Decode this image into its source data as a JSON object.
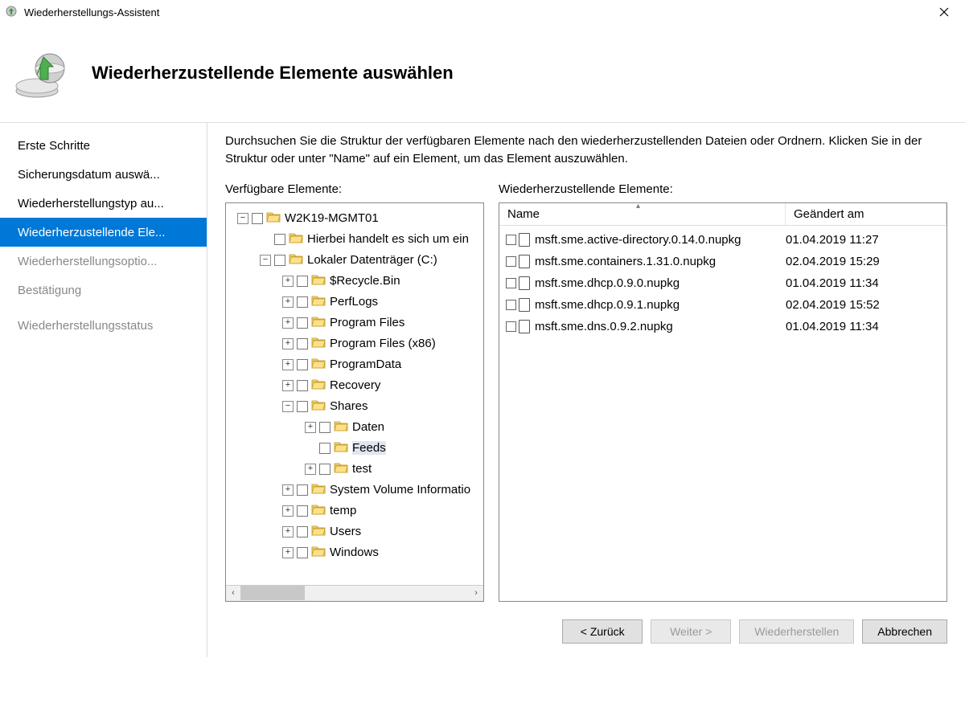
{
  "window": {
    "title": "Wiederherstellungs-Assistent"
  },
  "header": {
    "title": "Wiederherzustellende Elemente auswählen"
  },
  "steps": [
    {
      "label": "Erste Schritte",
      "state": "past"
    },
    {
      "label": "Sicherungsdatum auswä...",
      "state": "past"
    },
    {
      "label": "Wiederherstellungstyp au...",
      "state": "past"
    },
    {
      "label": "Wiederherzustellende Ele...",
      "state": "sel"
    },
    {
      "label": "Wiederherstellungsoptio...",
      "state": "dis"
    },
    {
      "label": "Bestätigung",
      "state": "dis"
    },
    {
      "label": "Wiederherstellungsstatus",
      "state": "dis"
    }
  ],
  "instructions": "Durchsuchen Sie die Struktur der verfügbaren Elemente nach den wiederherzustellenden Dateien oder Ordnern. Klicken Sie in der Struktur oder unter \"Name\" auf ein Element, um das Element auszuwählen.",
  "panes": {
    "left_label": "Verfügbare Elemente:",
    "right_label": "Wiederherzustellende Elemente:",
    "columns": {
      "name": "Name",
      "modified": "Geändert am"
    }
  },
  "tree": [
    {
      "depth": 0,
      "toggle": "-",
      "label": "W2K19-MGMT01",
      "selected": false
    },
    {
      "depth": 1,
      "toggle": "",
      "label": "Hierbei handelt es sich um ein",
      "selected": false
    },
    {
      "depth": 1,
      "toggle": "-",
      "label": "Lokaler Datenträger (C:)",
      "selected": false
    },
    {
      "depth": 2,
      "toggle": "+",
      "label": "$Recycle.Bin",
      "selected": false
    },
    {
      "depth": 2,
      "toggle": "+",
      "label": "PerfLogs",
      "selected": false
    },
    {
      "depth": 2,
      "toggle": "+",
      "label": "Program Files",
      "selected": false
    },
    {
      "depth": 2,
      "toggle": "+",
      "label": "Program Files (x86)",
      "selected": false
    },
    {
      "depth": 2,
      "toggle": "+",
      "label": "ProgramData",
      "selected": false
    },
    {
      "depth": 2,
      "toggle": "+",
      "label": "Recovery",
      "selected": false
    },
    {
      "depth": 2,
      "toggle": "-",
      "label": "Shares",
      "selected": false
    },
    {
      "depth": 3,
      "toggle": "+",
      "label": "Daten",
      "selected": false
    },
    {
      "depth": 3,
      "toggle": "",
      "label": "Feeds",
      "selected": true
    },
    {
      "depth": 3,
      "toggle": "+",
      "label": "test",
      "selected": false
    },
    {
      "depth": 2,
      "toggle": "+",
      "label": "System Volume Informatio",
      "selected": false
    },
    {
      "depth": 2,
      "toggle": "+",
      "label": "temp",
      "selected": false
    },
    {
      "depth": 2,
      "toggle": "+",
      "label": "Users",
      "selected": false
    },
    {
      "depth": 2,
      "toggle": "+",
      "label": "Windows",
      "selected": false
    }
  ],
  "files": [
    {
      "name": "msft.sme.active-directory.0.14.0.nupkg",
      "modified": "01.04.2019 11:27"
    },
    {
      "name": "msft.sme.containers.1.31.0.nupkg",
      "modified": "02.04.2019 15:29"
    },
    {
      "name": "msft.sme.dhcp.0.9.0.nupkg",
      "modified": "01.04.2019 11:34"
    },
    {
      "name": "msft.sme.dhcp.0.9.1.nupkg",
      "modified": "02.04.2019 15:52"
    },
    {
      "name": "msft.sme.dns.0.9.2.nupkg",
      "modified": "01.04.2019 11:34"
    }
  ],
  "buttons": {
    "back": "< Zurück",
    "next": "Weiter >",
    "restore": "Wiederherstellen",
    "cancel": "Abbrechen"
  }
}
